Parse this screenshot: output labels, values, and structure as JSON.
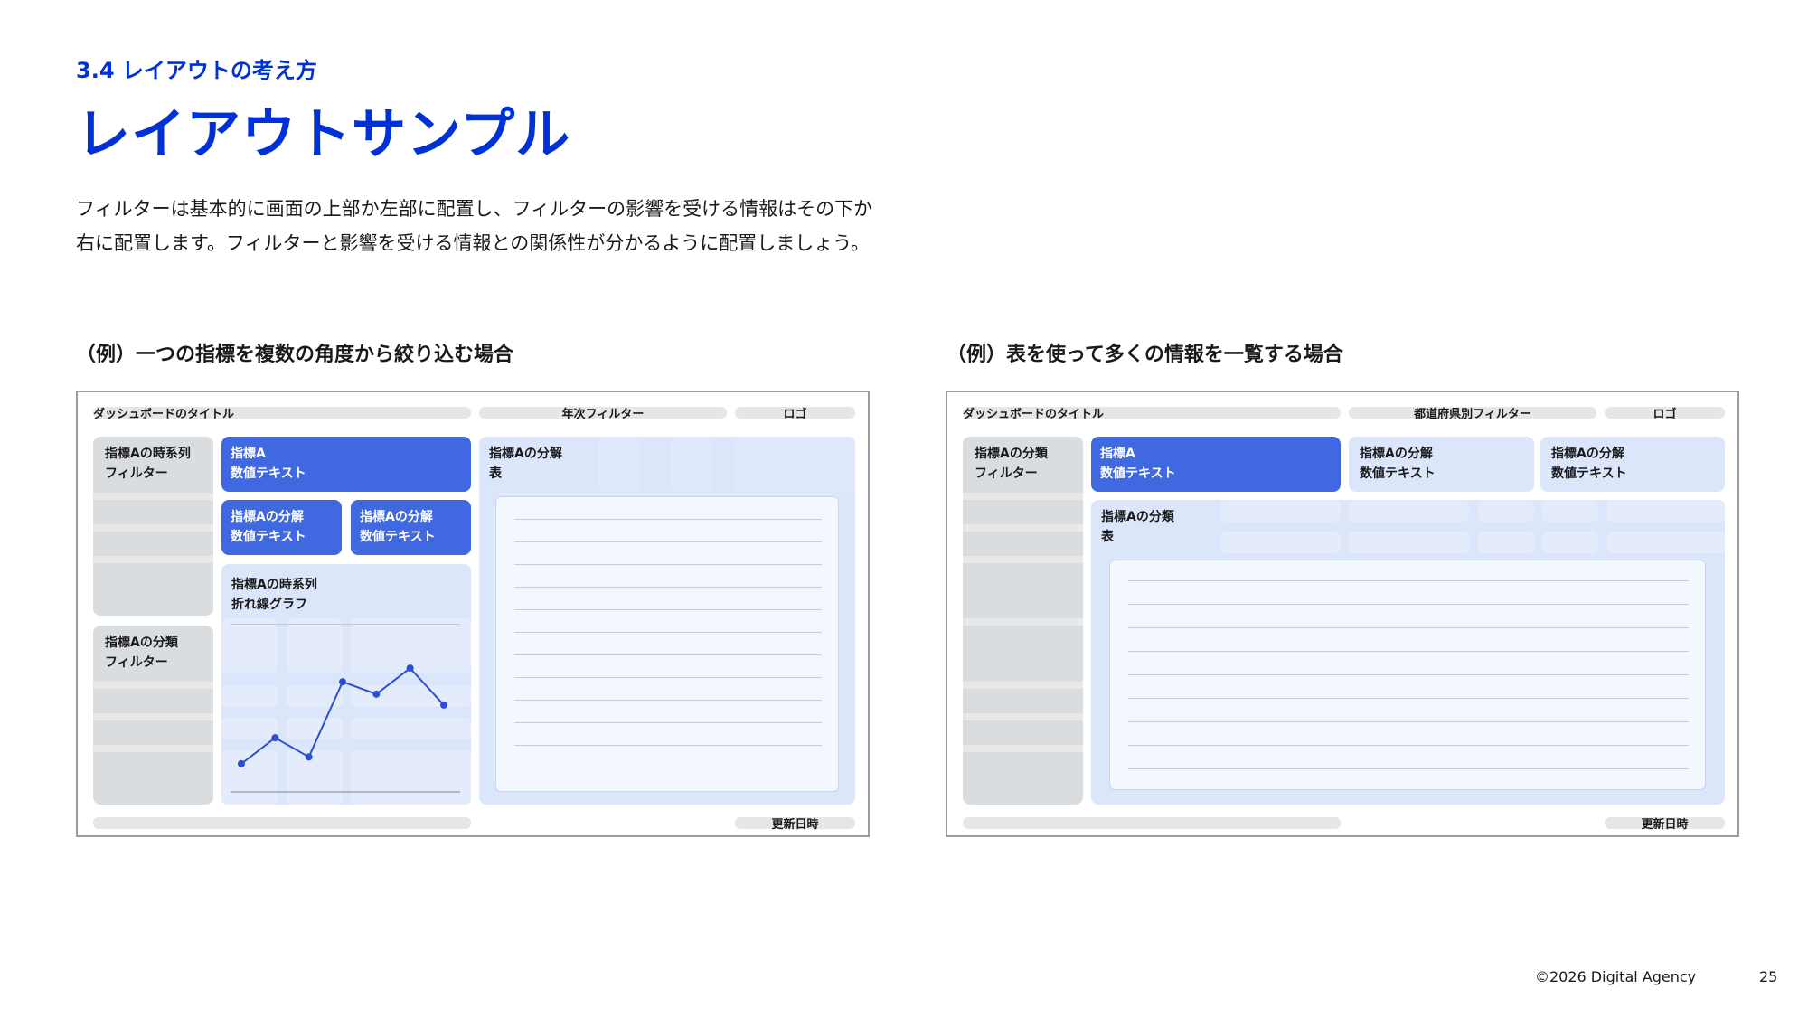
{
  "header": {
    "section_label": "3.4 レイアウトの考え方",
    "title": "レイアウトサンプル"
  },
  "description": "フィルターは基本的に画面の上部か左部に配置し、フィルターの影響を受ける情報はその下か右に配置します。フィルターと影響を受ける情報との関係性が分かるように配置しましょう。",
  "example_left": {
    "heading": "（例）一つの指標を複数の角度から絞り込む場合",
    "dashboard_title": "ダッシュボードのタイトル",
    "top_filter": "年次フィルター",
    "logo": "ロゴ",
    "filter_1": [
      "指標Aの時系列",
      "フィルター"
    ],
    "filter_2": [
      "指標Aの分類",
      "フィルター"
    ],
    "kpi_main": [
      "指標A",
      "数値テキスト"
    ],
    "kpi_sub_1": [
      "指標Aの分解",
      "数値テキスト"
    ],
    "kpi_sub_2": [
      "指標Aの分解",
      "数値テキスト"
    ],
    "chart_label": [
      "指標Aの時系列",
      "折れ線グラフ"
    ],
    "table_label": [
      "指標Aの分解",
      "表"
    ],
    "updated": "更新日時"
  },
  "example_right": {
    "heading": "（例）表を使って多くの情報を一覧する場合",
    "dashboard_title": "ダッシュボードのタイトル",
    "top_filter": "都道府県別フィルター",
    "logo": "ロゴ",
    "filter_1": [
      "指標Aの分類",
      "フィルター"
    ],
    "kpi_main": [
      "指標A",
      "数値テキスト"
    ],
    "kpi_sub_1": [
      "指標Aの分解",
      "数値テキスト"
    ],
    "kpi_sub_2": [
      "指標Aの分解",
      "数値テキスト"
    ],
    "table_label": [
      "指標Aの分類",
      "表"
    ],
    "updated": "更新日時"
  },
  "chart_data": {
    "type": "line",
    "title": "",
    "xlabel": "",
    "ylabel": "",
    "values": [
      1.0,
      2.9,
      1.5,
      7.0,
      6.1,
      8.0,
      5.3
    ],
    "ylim": [
      0,
      9
    ]
  },
  "footer": {
    "copyright": "©2026 Digital Agency",
    "page_number": "25"
  },
  "colors": {
    "accent": "#0031d8",
    "kpi_main": "#4068e0",
    "panel_light": "#dbe6fb",
    "filter_panel": "#dadddf"
  }
}
